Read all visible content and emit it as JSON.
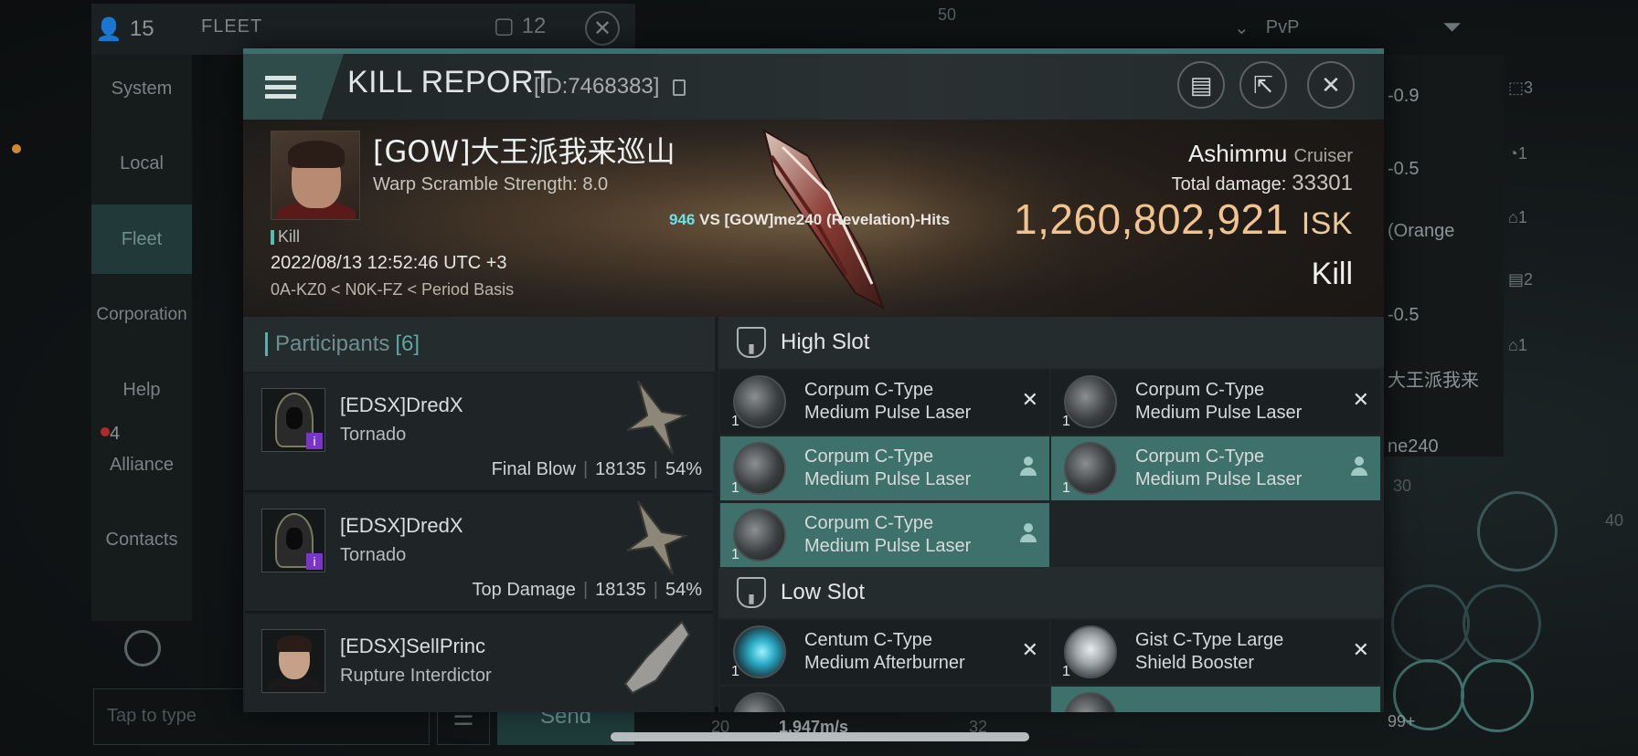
{
  "background": {
    "member_count": "15",
    "panel_title": "FLEET",
    "msg_count": "12",
    "nav": [
      "System",
      "Local",
      "Fleet",
      "Corporation",
      "Help",
      "Alliance",
      "Contacts"
    ],
    "alliance_badge": "4",
    "chat_placeholder": "Tap to type",
    "send_label": "Send",
    "filter_label": "PvP",
    "overview_values": [
      "-0.9",
      "-0.5",
      "(Orange",
      "-0.5",
      "大王派我来",
      "ne240"
    ],
    "right_counts": [
      "3",
      "1",
      "1",
      "2",
      "1"
    ],
    "speed": "1,947m/s",
    "scale_numbers": [
      "50",
      "30",
      "40",
      "20",
      "32",
      "99+"
    ]
  },
  "header": {
    "title": "KILL REPORT",
    "id": "[ID:7468383]"
  },
  "victim": {
    "name": "[GOW]大王派我来巡山",
    "warp_scramble": "Warp Scramble Strength: 8.0",
    "kill_label": "Kill",
    "datetime": "2022/08/13 12:52:46 UTC +3",
    "location": "0A-KZ0 < N0K-FZ < Period Basis",
    "hits": "946",
    "vs_text": "VS [GOW]me240 (Revelation)-Hits",
    "ship": "Ashimmu",
    "ship_class": "Cruiser",
    "total_damage_label": "Total damage:",
    "total_damage": "33301",
    "isk_value": "1,260,802,921",
    "isk_unit": "ISK",
    "result": "Kill"
  },
  "participants": {
    "title": "Participants",
    "count": "[6]",
    "rows": [
      {
        "name": "[EDSX]DredX",
        "ship": "Tornado",
        "role": "Final Blow",
        "damage": "18135",
        "percent": "54%"
      },
      {
        "name": "[EDSX]DredX",
        "ship": "Tornado",
        "role": "Top Damage",
        "damage": "18135",
        "percent": "54%"
      },
      {
        "name": "[EDSX]SellPrinc",
        "ship": "Rupture Interdictor",
        "role": "",
        "damage": "",
        "percent": ""
      }
    ]
  },
  "fitting": {
    "high_slot_title": "High Slot",
    "low_slot_title": "Low Slot",
    "high_slots": [
      {
        "line1": "Corpum C-Type",
        "line2": "Medium Pulse Laser",
        "qty": "1",
        "state": "destroyed"
      },
      {
        "line1": "Corpum C-Type",
        "line2": "Medium Pulse Laser",
        "qty": "1",
        "state": "destroyed"
      },
      {
        "line1": "Corpum C-Type",
        "line2": "Medium Pulse Laser",
        "qty": "1",
        "state": "dropped"
      },
      {
        "line1": "Corpum C-Type",
        "line2": "Medium Pulse Laser",
        "qty": "1",
        "state": "dropped"
      },
      {
        "line1": "Corpum C-Type",
        "line2": "Medium Pulse Laser",
        "qty": "1",
        "state": "dropped"
      }
    ],
    "low_slots": [
      {
        "line1": "Centum C-Type",
        "line2": "Medium Afterburner",
        "qty": "1",
        "state": "destroyed"
      },
      {
        "line1": "Gist C-Type Large",
        "line2": "Shield Booster",
        "qty": "1",
        "state": "destroyed"
      }
    ],
    "destroyed_mark": "✕"
  }
}
